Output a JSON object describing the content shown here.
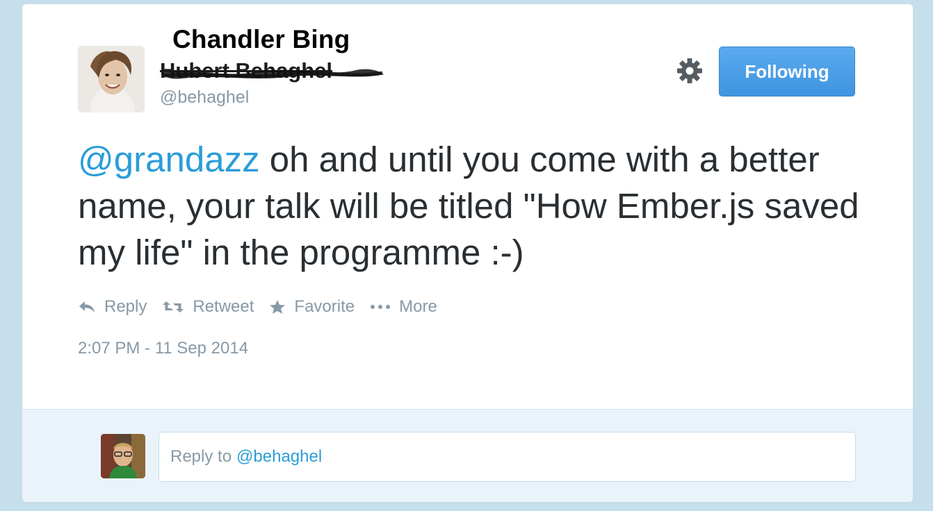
{
  "overlay_name": "Chandler Bing",
  "author": {
    "display_name": "Hubert Behaghel",
    "handle": "@behaghel",
    "avatar_icon": "profile-photo"
  },
  "follow_button": {
    "label": "Following",
    "color": "#4a9fe8"
  },
  "settings_icon": "gear-icon",
  "tweet": {
    "mention": "@grandazz",
    "text": " oh and until you come with a better name, your talk will be titled \"How Ember.js saved my life\" in the programme :-)"
  },
  "actions": {
    "reply": "Reply",
    "retweet": "Retweet",
    "favorite": "Favorite",
    "more": "More"
  },
  "timestamp": "2:07 PM - 11 Sep 2014",
  "reply_box": {
    "prefix": "Reply to",
    "mention": "@behaghel"
  },
  "colors": {
    "link": "#2b9dd8",
    "muted": "#8899a6",
    "text": "#292f33",
    "background": "#c5dfec"
  }
}
